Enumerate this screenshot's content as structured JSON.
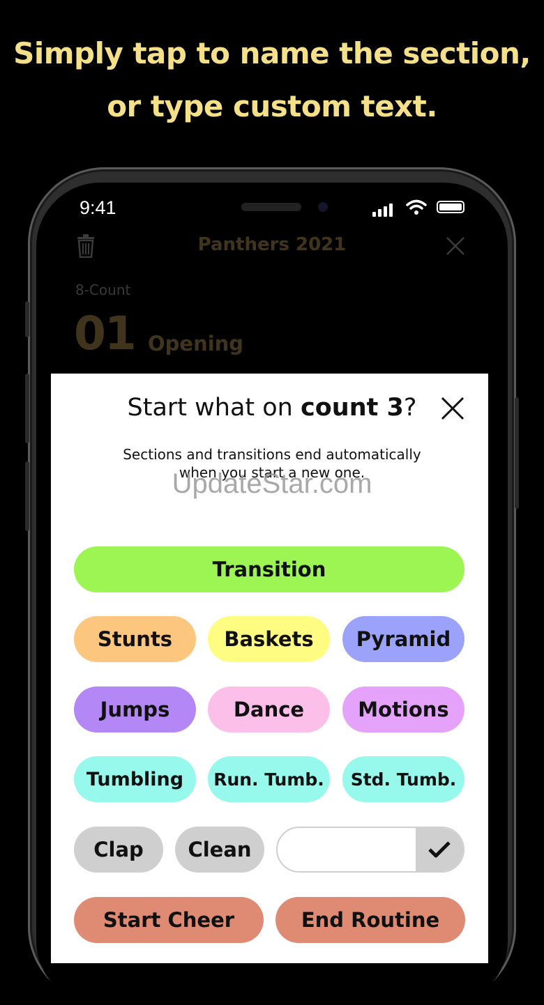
{
  "headline": {
    "line1": "Simply tap to name the section,",
    "line2": "or type custom text."
  },
  "status_bar": {
    "time": "9:41"
  },
  "app": {
    "title": "Panthers 2021",
    "count_label": "8-Count",
    "count_number": "01",
    "section_name": "Opening"
  },
  "modal": {
    "title_prefix": "Start what on ",
    "title_bold": "count 3",
    "title_suffix": "?",
    "subtitle_line1": "Sections and transitions end automatically",
    "subtitle_line2": "when you start a new one.",
    "buttons": {
      "transition": "Transition",
      "stunts": "Stunts",
      "baskets": "Baskets",
      "pyramid": "Pyramid",
      "jumps": "Jumps",
      "dance": "Dance",
      "motions": "Motions",
      "tumbling": "Tumbling",
      "run_tumb": "Run. Tumb.",
      "std_tumb": "Std. Tumb.",
      "clap": "Clap",
      "clean": "Clean",
      "start_cheer": "Start Cheer",
      "end_routine": "End Routine"
    },
    "custom_input": {
      "value": "",
      "placeholder": ""
    }
  },
  "watermark": "UpdateStar.com",
  "colors": {
    "headline": "#f5e08a",
    "transition": "#9cf553",
    "stunts": "#fdc67e",
    "baskets": "#fefd82",
    "pyramid": "#9aa2fa",
    "jumps": "#b487f7",
    "dance": "#fcbfe9",
    "motions": "#e4a2fa",
    "tumbling": "#97f9ec",
    "gray": "#cfcfcf",
    "salmon": "#df8a72"
  }
}
